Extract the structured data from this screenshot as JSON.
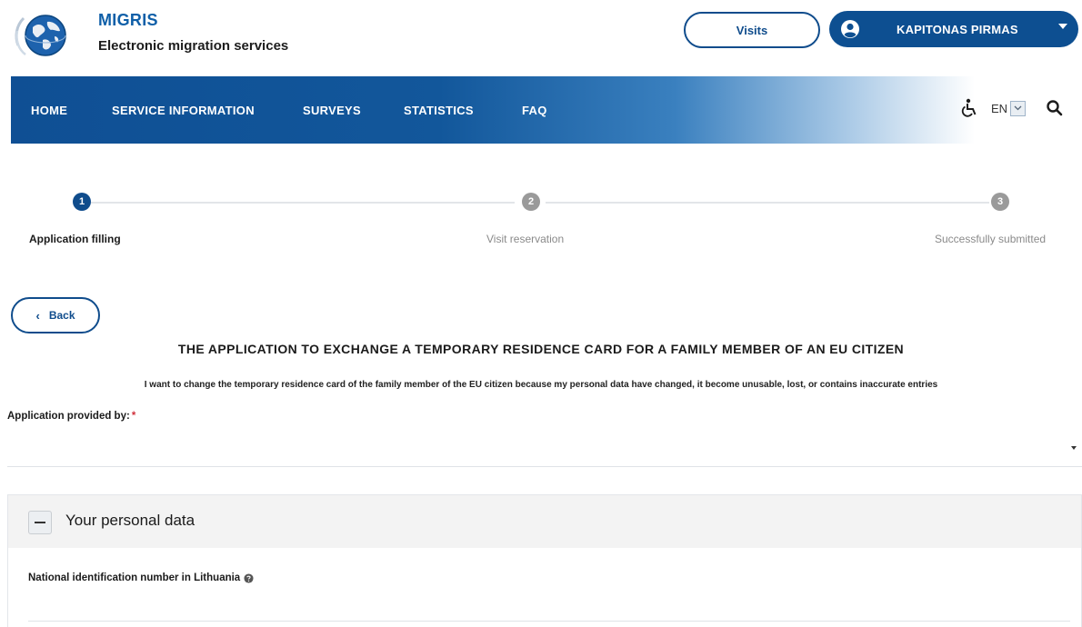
{
  "header": {
    "brand_name": "MIGRIS",
    "brand_subtitle": "Electronic migration services",
    "visits_label": "Visits",
    "user_name": "KAPITONAS PIRMAS"
  },
  "nav": {
    "items": [
      "HOME",
      "SERVICE INFORMATION",
      "SURVEYS",
      "STATISTICS",
      "FAQ"
    ],
    "language": "EN"
  },
  "stepper": {
    "steps": [
      {
        "number": "1",
        "label": "Application filling",
        "state": "active"
      },
      {
        "number": "2",
        "label": "Visit reservation",
        "state": "inactive"
      },
      {
        "number": "3",
        "label": "Successfully submitted",
        "state": "inactive"
      }
    ]
  },
  "page": {
    "back_label": "Back",
    "title": "THE APPLICATION TO EXCHANGE A TEMPORARY RESIDENCE CARD FOR A FAMILY MEMBER OF AN EU CITIZEN",
    "subtitle": "I want to change the temporary residence card of the family member of the EU citizen because my personal data have changed, it become unusable, lost, or contains inaccurate entries",
    "provided_by_label": "Application provided by:",
    "required_mark": "*",
    "provided_by_value": ""
  },
  "personal_data": {
    "section_title": "Your personal data",
    "national_id_label": "National identification number in Lithuania",
    "national_id_value": ""
  },
  "colors": {
    "primary": "#0d4f91",
    "active_step": "#0f4c8c",
    "inactive_step": "#9a9a9a",
    "required": "#d0313c"
  },
  "icons": {
    "logo": "globe-logo-icon",
    "user": "user-circle-icon",
    "accessibility": "accessibility-icon",
    "search": "search-icon",
    "help": "help-icon"
  }
}
